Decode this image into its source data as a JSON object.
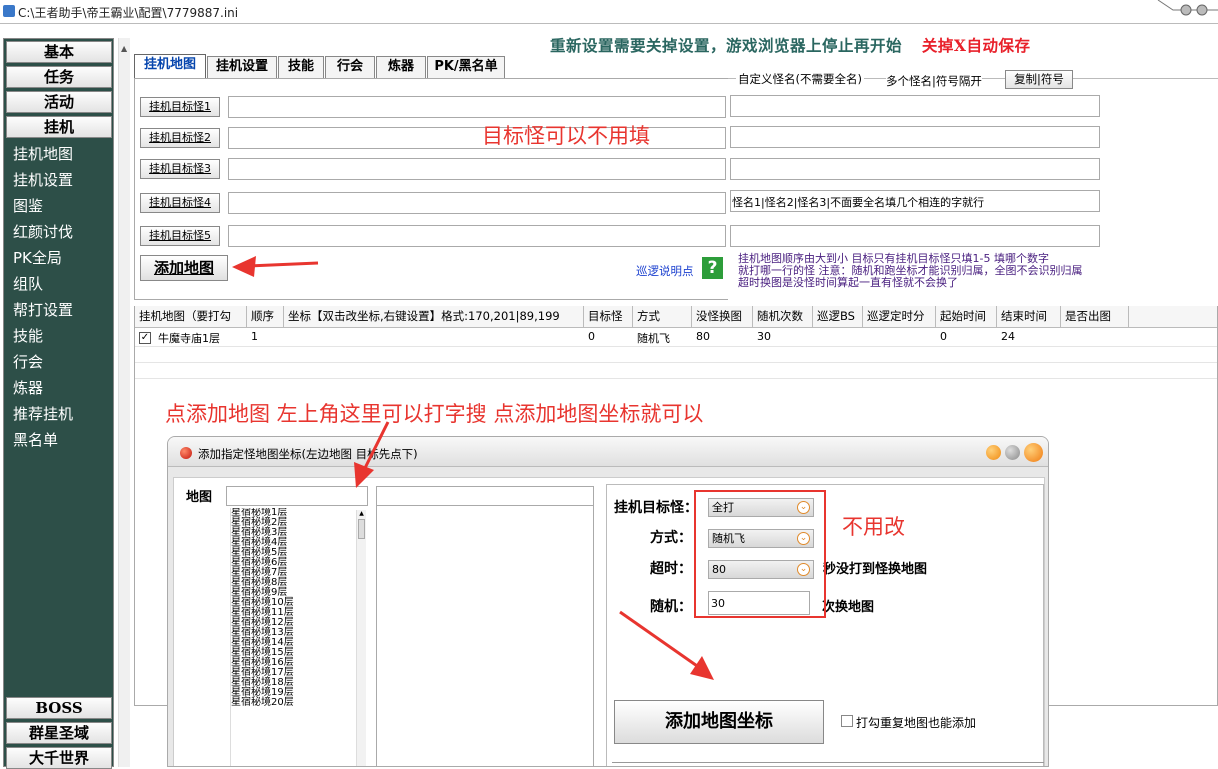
{
  "window": {
    "title": "C:\\王者助手\\帝王霸业\\配置\\7779887.ini"
  },
  "notice": {
    "main": "重新设置需要关掉设置，游戏浏览器上停止再开始",
    "red": "关掉X自动保存"
  },
  "sidebar": {
    "top_buttons": [
      "基本",
      "任务",
      "活动",
      "挂机"
    ],
    "items": [
      "挂机地图",
      "挂机设置",
      "图鉴",
      "红颜讨伐",
      "PK全局",
      "组队",
      "帮打设置",
      "技能",
      "行会",
      "炼器",
      "推荐挂机",
      "黑名单"
    ],
    "bottom_buttons": [
      "BOSS",
      "群星圣域",
      "大千世界"
    ]
  },
  "tabs": [
    "挂机地图",
    "挂机设置",
    "技能",
    "行会",
    "炼器",
    "PK/黑名单"
  ],
  "targets": {
    "buttons": [
      "挂机目标怪1",
      "挂机目标怪2",
      "挂机目标怪3",
      "挂机目标怪4",
      "挂机目标怪5"
    ]
  },
  "custom": {
    "legend": "自定义怪名(不需要全名)",
    "note": "多个怪名|符号隔开",
    "copy_button": "复制|符号",
    "field4_value": "怪名1|怪名2|怪名3|不面要全名填几个相连的字就行"
  },
  "help_text": [
    "挂机地图顺序由大到小  目标只有挂机目标怪只填1-5  填哪个数字",
    "就打哪一行的怪  注意：随机和跑坐标才能识别归属，全图不会识别归属",
    "超时换图是没怪时间算起一直有怪就不会换了"
  ],
  "add_map_button": "添加地图",
  "patrol_link": "巡逻说明点",
  "help_icon": "?",
  "annotations": {
    "a1": "目标怪可以不用填",
    "a2": "点添加地图 左上角这里可以打字搜 点添加地图坐标就可以",
    "a3": "不用改"
  },
  "table": {
    "headers": [
      "挂机地图（要打勾",
      "顺序",
      "坐标【双击改坐标,右键设置】格式:170,201|89,199",
      "目标怪",
      "方式",
      "没怪换图",
      "随机次数",
      "巡逻BS",
      "巡逻定时分",
      "起始时间",
      "结束时间",
      "是否出图"
    ],
    "row": {
      "map": "牛魔寺庙1层",
      "order": "1",
      "target": "0",
      "mode": "随机飞",
      "timeout": "80",
      "random": "30",
      "start": "0",
      "end": "24"
    }
  },
  "dialog": {
    "title": "添加指定怪地图坐标(左边地图 目标先点下)",
    "map_label": "地图",
    "map_list": [
      "星宿秘境1层",
      "星宿秘境2层",
      "星宿秘境3层",
      "星宿秘境4层",
      "星宿秘境5层",
      "星宿秘境6层",
      "星宿秘境7层",
      "星宿秘境8层",
      "星宿秘境9层",
      "星宿秘境10层",
      "星宿秘境11层",
      "星宿秘境12层",
      "星宿秘境13层",
      "星宿秘境14层",
      "星宿秘境15层",
      "星宿秘境16层",
      "星宿秘境17层",
      "星宿秘境18层",
      "星宿秘境19层",
      "星宿秘境20层"
    ],
    "target_label": "挂机目标怪：",
    "target_value": "全打",
    "mode_label": "方式：",
    "mode_value": "随机飞",
    "timeout_label": "超时：",
    "timeout_value": "80",
    "timeout_suffix": "秒没打到怪换地图",
    "random_label": "随机：",
    "random_value": "30",
    "random_suffix": "次换地图",
    "add_coord_button": "添加地图坐标",
    "repeat_checkbox": "打勾重复地图也能添加"
  },
  "colors": {
    "sidebar_bg": "#2d4f48",
    "annotation": "#e8352f",
    "notice_teal": "#2a6660",
    "tab_active": "#0645ad",
    "help_purple": "#4a2080"
  }
}
